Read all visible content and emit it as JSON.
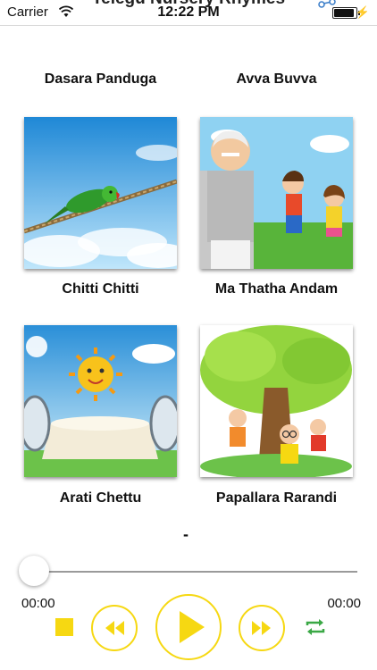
{
  "status": {
    "carrier": "Carrier",
    "time": "12:22 PM",
    "app_title": "Telegu Nursery Rhymes"
  },
  "grid": {
    "top_labels": [
      "Dasara Panduga",
      "Avva Buvva"
    ],
    "items": [
      {
        "title": "Chitti Chitti",
        "icon": "parrot-image"
      },
      {
        "title": "Ma Thatha Andam",
        "icon": "grandfather-kids-image"
      },
      {
        "title": "Arati Chettu",
        "icon": "sun-table-image"
      },
      {
        "title": "Papallara Rarandi",
        "icon": "tree-kids-image"
      }
    ]
  },
  "player": {
    "current_song": "-",
    "elapsed": "00:00",
    "duration": "00:00",
    "progress": 0,
    "accent": "#f6d812",
    "repeat_color": "#3aa845"
  }
}
